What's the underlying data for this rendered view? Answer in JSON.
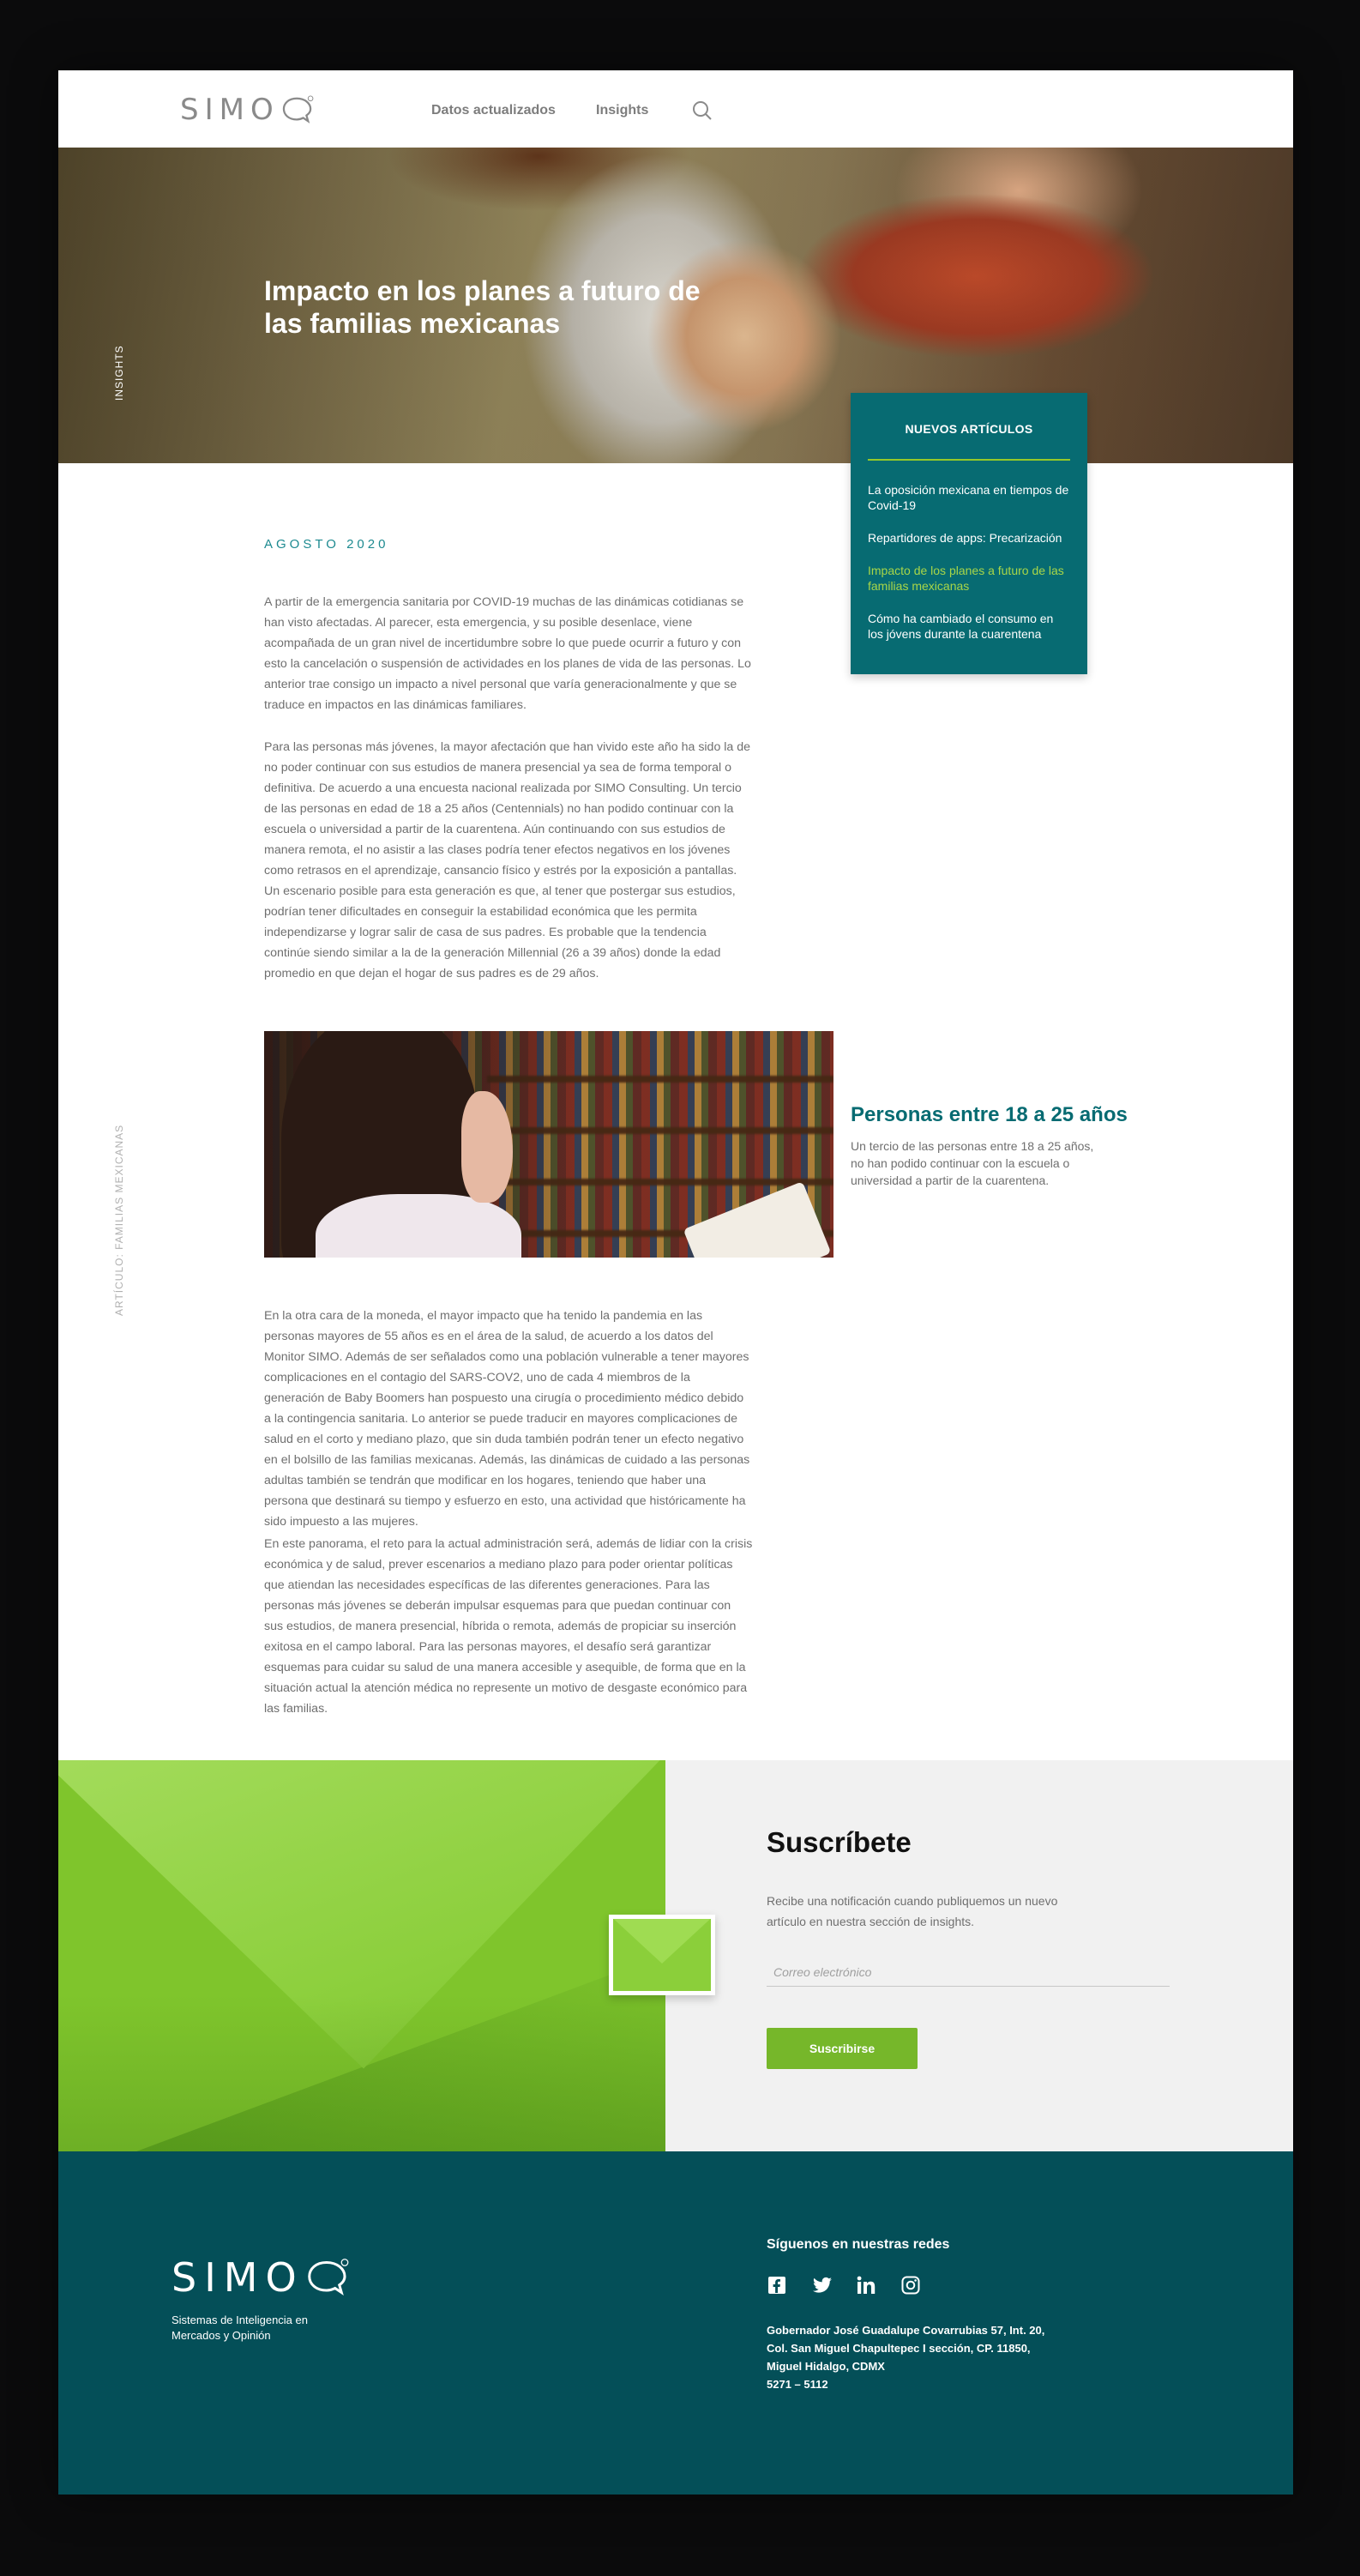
{
  "header": {
    "logo_text": "SIMO",
    "nav": [
      "Datos actualizados",
      "Insights"
    ]
  },
  "hero": {
    "side_label": "INSIGHTS",
    "title": "Impacto en los planes a futuro de las familias mexicanas"
  },
  "sidebar_label": "ARTÍCULO: FAMILIAS MEXICANAS",
  "new_articles": {
    "title": "NUEVOS ARTÍCULOS",
    "items": [
      "La oposición mexicana en tiempos de Covid-19",
      "Repartidores de apps: Precarización",
      "Impacto de los planes a futuro de las familias mexicanas",
      "Cómo ha cambiado el consumo en los jóvens durante la cuarentena"
    ],
    "active_index": 2
  },
  "article": {
    "date": "AGOSTO 2020",
    "paragraphs": [
      "A partir de la emergencia sanitaria por COVID-19 muchas de las dinámicas cotidianas se han visto afectadas. Al parecer, esta emergencia, y su posible desenlace, viene acompañada de un gran nivel de incertidumbre sobre lo que puede ocurrir a futuro y con esto la cancelación o suspensión de actividades en los planes de vida de las personas. Lo anterior trae consigo un impacto a nivel personal que varía generacionalmente y que se traduce en impactos en las dinámicas familiares.",
      "Para las personas más jóvenes, la mayor afectación que han vivido este año ha sido la de no poder continuar con sus estudios de manera presencial ya sea de forma temporal o definitiva.  De acuerdo a una encuesta nacional realizada por SIMO Consulting. Un tercio de las personas en edad de 18 a 25 años (Centennials) no han podido continuar con la escuela o universidad a partir de la cuarentena. Aún continuando con sus estudios de manera remota, el no asistir a las clases podría tener efectos negativos en los jóvenes como retrasos en el aprendizaje, cansancio físico y estrés por la exposición a pantallas. Un escenario posible para esta generación es que, al tener que postergar sus estudios, podrían tener dificultades en conseguir la estabilidad económica que les permita independizarse y lograr salir de casa de sus padres. Es probable que la tendencia continúe siendo similar a la de la generación Millennial (26 a 39 años) donde la edad promedio en que dejan el hogar de sus padres es de 29 años.",
      "En la otra cara de la moneda, el mayor impacto que ha tenido la pandemia en las personas mayores de 55 años es en el área de la salud, de acuerdo a los datos del Monitor SIMO. Además de ser señalados como una población vulnerable a tener mayores complicaciones en el contagio del SARS-COV2, uno de cada 4 miembros de la generación de Baby Boomers han pospuesto una cirugía o procedimiento médico debido a la contingencia sanitaria. Lo anterior se puede traducir en mayores complicaciones de salud en el corto y mediano plazo, que sin duda también podrán tener un efecto negativo en el bolsillo de las familias mexicanas. Además, las dinámicas de cuidado a las personas adultas también se tendrán que modificar en los hogares, teniendo que haber una persona que destinará su tiempo y esfuerzo en esto,  una actividad que históricamente ha sido impuesto a las mujeres.",
      "En este panorama, el reto para la actual administración será, además de lidiar con la crisis económica y de salud, prever escenarios a mediano plazo para poder orientar políticas que atiendan las necesidades específicas de las diferentes generaciones. Para las personas más jóvenes se deberán impulsar esquemas para que puedan continuar con sus estudios, de manera presencial, híbrida o remota, además de propiciar su inserción exitosa en el campo laboral. Para las personas mayores, el desafío será garantizar esquemas para cuidar su salud de una manera accesible y asequible, de forma que en la situación actual la atención médica no represente un motivo de desgaste económico para las familias."
    ],
    "callout": {
      "title": "Personas entre 18 a 25 años",
      "text": "Un tercio de las personas entre 18 a 25 años, no han podido continuar con la escuela o universidad a partir de la cuarentena."
    }
  },
  "subscribe": {
    "title": "Suscríbete",
    "text": "Recibe una notificación cuando publiquemos un nuevo artículo en nuestra sección de insights.",
    "email_placeholder": "Correo electrónico",
    "button": "Suscribirse"
  },
  "footer": {
    "logo_text": "SIMO",
    "tagline": "Sistemas de Inteligencia en Mercados y Opinión",
    "follow": "Síguenos en nuestras redes",
    "socials": [
      "facebook-icon",
      "twitter-icon",
      "linkedin-icon",
      "instagram-icon"
    ],
    "address_lines": [
      "Gobernador José Guadalupe Covarrubias 57, Int. 20,",
      "Col. San Miguel Chapultepec I sección, CP. 11850,",
      "Miguel Hidalgo, CDMX",
      "5271 – 5112"
    ]
  },
  "colors": {
    "teal": "#076b72",
    "dark_teal": "#044f58",
    "green": "#76b72a",
    "highlight": "#a8d648"
  }
}
